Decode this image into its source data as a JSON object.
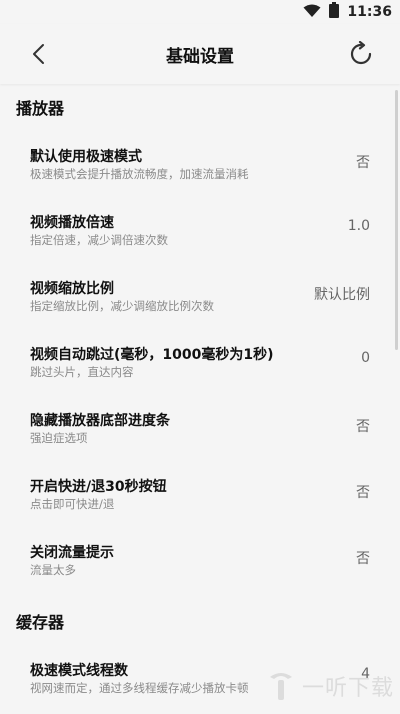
{
  "status_bar": {
    "time": "11:36",
    "icons": [
      "wifi-icon",
      "battery-icon"
    ]
  },
  "app_bar": {
    "title": "基础设置",
    "back_icon": "back-arrow-icon",
    "refresh_icon": "refresh-icon"
  },
  "sections": [
    {
      "title": "播放器",
      "items": [
        {
          "title": "默认使用极速模式",
          "desc": "极速模式会提升播放流畅度，加速流量消耗",
          "value": "否"
        },
        {
          "title": "视频播放倍速",
          "desc": "指定倍速，减少调倍速次数",
          "value": "1.0"
        },
        {
          "title": "视频缩放比例",
          "desc": "指定缩放比例，减少调缩放比例次数",
          "value": "默认比例"
        },
        {
          "title": "视频自动跳过(毫秒，1000毫秒为1秒)",
          "desc": "跳过头片，直达内容",
          "value": "0"
        },
        {
          "title": "隐藏播放器底部进度条",
          "desc": "强迫症选项",
          "value": "否"
        },
        {
          "title": "开启快进/退30秒按钮",
          "desc": "点击即可快进/退",
          "value": "否"
        },
        {
          "title": "关闭流量提示",
          "desc": "流量太多",
          "value": "否"
        }
      ]
    },
    {
      "title": "缓存器",
      "items": [
        {
          "title": "极速模式线程数",
          "desc": "视网速而定，通过多线程缓存减少播放卡顿",
          "value": "4"
        }
      ]
    }
  ],
  "watermark": {
    "text": "一听下载"
  }
}
